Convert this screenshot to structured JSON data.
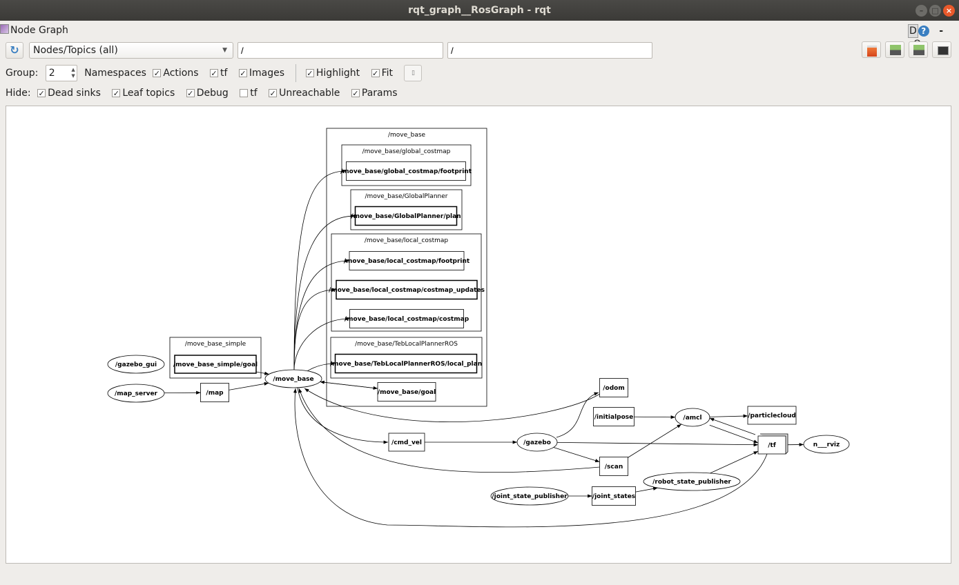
{
  "window": {
    "title": "rqt_graph__RosGraph - rqt"
  },
  "plugin": {
    "title": "Node Graph",
    "d_label": "D",
    "help_label": "?",
    "dash": "-",
    "o": "O"
  },
  "toolbar": {
    "view_mode": "Nodes/Topics (all)",
    "node_filter": "/",
    "topic_filter": "/"
  },
  "options": {
    "group_label": "Group:",
    "group_value": "2",
    "items": [
      {
        "label": "Namespaces",
        "checked": null
      },
      {
        "label": "Actions",
        "checked": true
      },
      {
        "label": "tf",
        "checked": true
      },
      {
        "label": "Images",
        "checked": true
      },
      {
        "label": "Highlight",
        "checked": true
      },
      {
        "label": "Fit",
        "checked": true
      }
    ]
  },
  "hide": {
    "label": "Hide:",
    "items": [
      {
        "label": "Dead sinks",
        "checked": true
      },
      {
        "label": "Leaf topics",
        "checked": true
      },
      {
        "label": "Debug",
        "checked": true
      },
      {
        "label": "tf",
        "checked": false
      },
      {
        "label": "Unreachable",
        "checked": true
      },
      {
        "label": "Params",
        "checked": true
      }
    ]
  },
  "graph": {
    "clusters": [
      {
        "id": "c_mbs",
        "label": "/move_base_simple"
      },
      {
        "id": "c_mb",
        "label": "/move_base"
      },
      {
        "id": "c_gc",
        "label": "/move_base/global_costmap"
      },
      {
        "id": "c_gp",
        "label": "/move_base/GlobalPlanner"
      },
      {
        "id": "c_lc",
        "label": "/move_base/local_costmap"
      },
      {
        "id": "c_teb",
        "label": "/move_base/TebLocalPlannerROS"
      }
    ],
    "nodes": [
      {
        "id": "gazebo_gui",
        "label": "/gazebo_gui",
        "shape": "ellipse"
      },
      {
        "id": "map_server",
        "label": "/map_server",
        "shape": "ellipse"
      },
      {
        "id": "mbs_goal",
        "label": "/move_base_simple/goal",
        "shape": "box"
      },
      {
        "id": "map",
        "label": "/map",
        "shape": "box"
      },
      {
        "id": "move_base",
        "label": "/move_base",
        "shape": "ellipse"
      },
      {
        "id": "gc_fp",
        "label": "/move_base/global_costmap/footprint",
        "shape": "box"
      },
      {
        "id": "gp_plan",
        "label": "/move_base/GlobalPlanner/plan",
        "shape": "box"
      },
      {
        "id": "lc_fp",
        "label": "/move_base/local_costmap/footprint",
        "shape": "box"
      },
      {
        "id": "lc_upd",
        "label": "/move_base/local_costmap/costmap_updates",
        "shape": "box"
      },
      {
        "id": "lc_cm",
        "label": "/move_base/local_costmap/costmap",
        "shape": "box"
      },
      {
        "id": "teb_plan",
        "label": "/move_base/TebLocalPlannerROS/local_plan",
        "shape": "box"
      },
      {
        "id": "mb_goal",
        "label": "/move_base/goal",
        "shape": "box"
      },
      {
        "id": "odom",
        "label": "/odom",
        "shape": "box"
      },
      {
        "id": "initialpose",
        "label": "/initialpose",
        "shape": "box"
      },
      {
        "id": "amcl",
        "label": "/amcl",
        "shape": "ellipse"
      },
      {
        "id": "particlecloud",
        "label": "/particlecloud",
        "shape": "box"
      },
      {
        "id": "tf",
        "label": "/tf",
        "shape": "box3d"
      },
      {
        "id": "rviz",
        "label": "n___rviz",
        "shape": "ellipse"
      },
      {
        "id": "cmd_vel",
        "label": "/cmd_vel",
        "shape": "box"
      },
      {
        "id": "gazebo",
        "label": "/gazebo",
        "shape": "ellipse"
      },
      {
        "id": "scan",
        "label": "/scan",
        "shape": "box"
      },
      {
        "id": "rsp",
        "label": "/robot_state_publisher",
        "shape": "ellipse"
      },
      {
        "id": "jsp",
        "label": "/joint_state_publisher",
        "shape": "ellipse"
      },
      {
        "id": "joint_states",
        "label": "/joint_states",
        "shape": "box"
      }
    ],
    "edges": [
      [
        "map_server",
        "map"
      ],
      [
        "map",
        "move_base"
      ],
      [
        "mbs_goal",
        "move_base"
      ],
      [
        "move_base",
        "gc_fp"
      ],
      [
        "move_base",
        "gp_plan"
      ],
      [
        "move_base",
        "lc_fp"
      ],
      [
        "move_base",
        "lc_upd"
      ],
      [
        "move_base",
        "lc_cm"
      ],
      [
        "move_base",
        "teb_plan"
      ],
      [
        "move_base",
        "mb_goal"
      ],
      [
        "mb_goal",
        "move_base"
      ],
      [
        "move_base",
        "cmd_vel"
      ],
      [
        "odom",
        "move_base"
      ],
      [
        "scan",
        "move_base"
      ],
      [
        "tf",
        "move_base"
      ],
      [
        "cmd_vel",
        "gazebo"
      ],
      [
        "gazebo",
        "odom"
      ],
      [
        "gazebo",
        "scan"
      ],
      [
        "gazebo",
        "tf"
      ],
      [
        "initialpose",
        "amcl"
      ],
      [
        "amcl",
        "particlecloud"
      ],
      [
        "amcl",
        "tf"
      ],
      [
        "tf",
        "amcl"
      ],
      [
        "tf",
        "rviz"
      ],
      [
        "scan",
        "amcl"
      ],
      [
        "jsp",
        "joint_states"
      ],
      [
        "joint_states",
        "rsp"
      ],
      [
        "rsp",
        "tf"
      ]
    ]
  }
}
